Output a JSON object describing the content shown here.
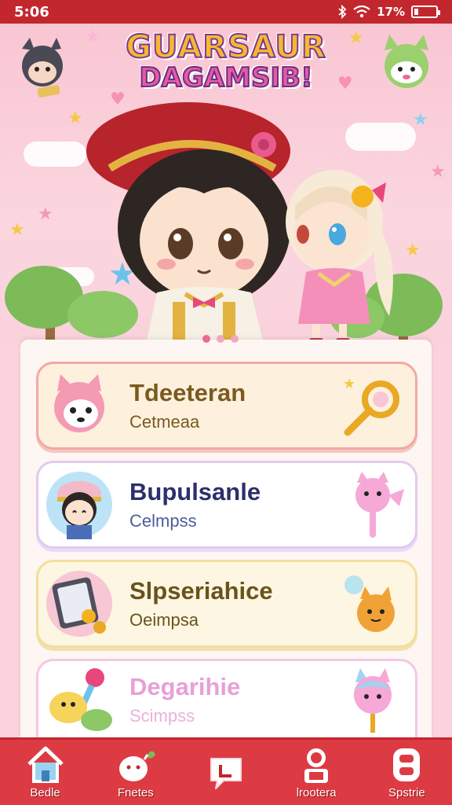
{
  "status_bar": {
    "time": "5:06",
    "battery": "17%",
    "battery_level": 0.17,
    "icons": [
      "bluetooth-icon",
      "wifi-icon",
      "battery-icon"
    ]
  },
  "hero": {
    "logo_line1": "GUARSAUR",
    "logo_line2": "DAGAMSIB!",
    "carousel_pages": 3,
    "carousel_active": 0
  },
  "cards": [
    {
      "title": "Tdeeteran",
      "subtitle": "Cetmeaa"
    },
    {
      "title": "Bupulsanle",
      "subtitle": "Celmpss"
    },
    {
      "title": "Slpseriahice",
      "subtitle": "Oeimpsa"
    },
    {
      "title": "Degarihie",
      "subtitle": "Scimpss"
    }
  ],
  "nav": [
    {
      "label": "Bedle",
      "icon": "home-icon"
    },
    {
      "label": "Fnetes",
      "icon": "pet-icon"
    },
    {
      "label": "",
      "icon": "chat-icon"
    },
    {
      "label": "lrootera",
      "icon": "profile-icon"
    },
    {
      "label": "Spstrie",
      "icon": "settings-icon"
    }
  ],
  "colors": {
    "brand_red": "#dd3b43",
    "status_red": "#c2272d",
    "background_pink": "#fbd3dc"
  }
}
